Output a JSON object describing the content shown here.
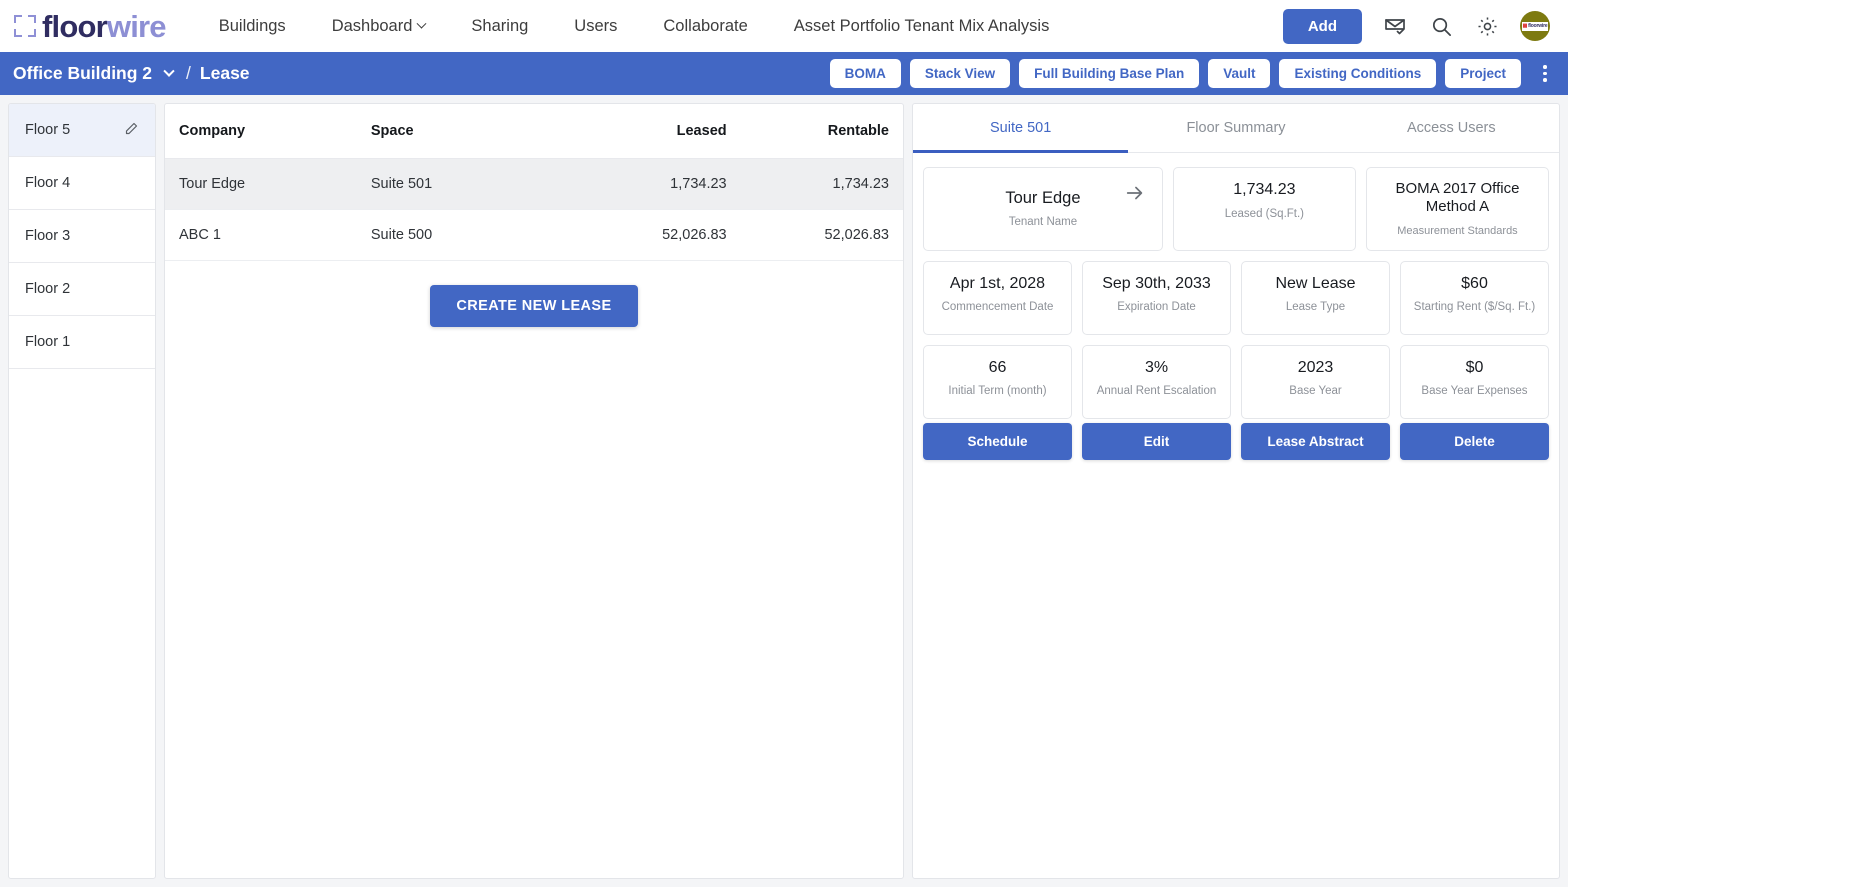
{
  "brand": {
    "logo_first": "floor",
    "logo_second": "wire",
    "accent_blue": "#4267c4",
    "logo_dark": "#302d61",
    "logo_light": "#8d8fd4",
    "avatar_bg": "#7d7a10",
    "avatar_text": "floorwire"
  },
  "topnav": {
    "links": [
      {
        "label": "Buildings",
        "has_caret": false
      },
      {
        "label": "Dashboard",
        "has_caret": true
      },
      {
        "label": "Sharing",
        "has_caret": false
      },
      {
        "label": "Users",
        "has_caret": false
      },
      {
        "label": "Collaborate",
        "has_caret": false
      },
      {
        "label": "Asset Portfolio Tenant Mix Analysis",
        "has_caret": false
      }
    ],
    "add_label": "Add",
    "icons": [
      "mail-check-icon",
      "search-icon",
      "gear-icon"
    ]
  },
  "subbar": {
    "building": "Office Building 2",
    "separator": "/",
    "current": "Lease",
    "actions": [
      {
        "label": "BOMA"
      },
      {
        "label": "Stack View"
      },
      {
        "label": "Full Building Base Plan"
      },
      {
        "label": "Vault"
      },
      {
        "label": "Existing Conditions"
      },
      {
        "label": "Project"
      }
    ]
  },
  "floors": {
    "items": [
      {
        "label": "Floor 5",
        "active": true,
        "editable": true
      },
      {
        "label": "Floor 4",
        "active": false,
        "editable": false
      },
      {
        "label": "Floor 3",
        "active": false,
        "editable": false
      },
      {
        "label": "Floor 2",
        "active": false,
        "editable": false
      },
      {
        "label": "Floor 1",
        "active": false,
        "editable": false
      }
    ]
  },
  "lease_table": {
    "headers": [
      "Company",
      "Space",
      "Leased",
      "Rentable"
    ],
    "rows": [
      {
        "company": "Tour Edge",
        "space": "Suite 501",
        "leased": "1,734.23",
        "rentable": "1,734.23",
        "selected": true
      },
      {
        "company": "ABC 1",
        "space": "Suite 500",
        "leased": "52,026.83",
        "rentable": "52,026.83",
        "selected": false
      }
    ],
    "create_label": "CREATE NEW LEASE"
  },
  "detail": {
    "tabs": [
      {
        "label": "Suite 501",
        "active": true
      },
      {
        "label": "Floor Summary",
        "active": false
      },
      {
        "label": "Access Users",
        "active": false
      }
    ],
    "row1": [
      {
        "value": "Tour Edge",
        "label": "Tenant Name",
        "kind": "tenant"
      },
      {
        "value": "1,734.23",
        "label": "Leased (Sq.Ft.)",
        "kind": "plain"
      },
      {
        "value": "BOMA 2017 Office Method A",
        "label": "Measurement Standards",
        "kind": "boma"
      }
    ],
    "row2": [
      {
        "value": "Apr 1st, 2028",
        "label": "Commencement Date"
      },
      {
        "value": "Sep 30th, 2033",
        "label": "Expiration Date"
      },
      {
        "value": "New Lease",
        "label": "Lease Type"
      },
      {
        "value": "$60",
        "label": "Starting Rent ($/Sq. Ft.)"
      }
    ],
    "row3": [
      {
        "value": "66",
        "label": "Initial Term (month)"
      },
      {
        "value": "3%",
        "label": "Annual Rent Escalation"
      },
      {
        "value": "2023",
        "label": "Base Year"
      },
      {
        "value": "$0",
        "label": "Base Year Expenses"
      }
    ],
    "actions": [
      {
        "label": "Schedule"
      },
      {
        "label": "Edit"
      },
      {
        "label": "Lease Abstract"
      },
      {
        "label": "Delete"
      }
    ]
  }
}
